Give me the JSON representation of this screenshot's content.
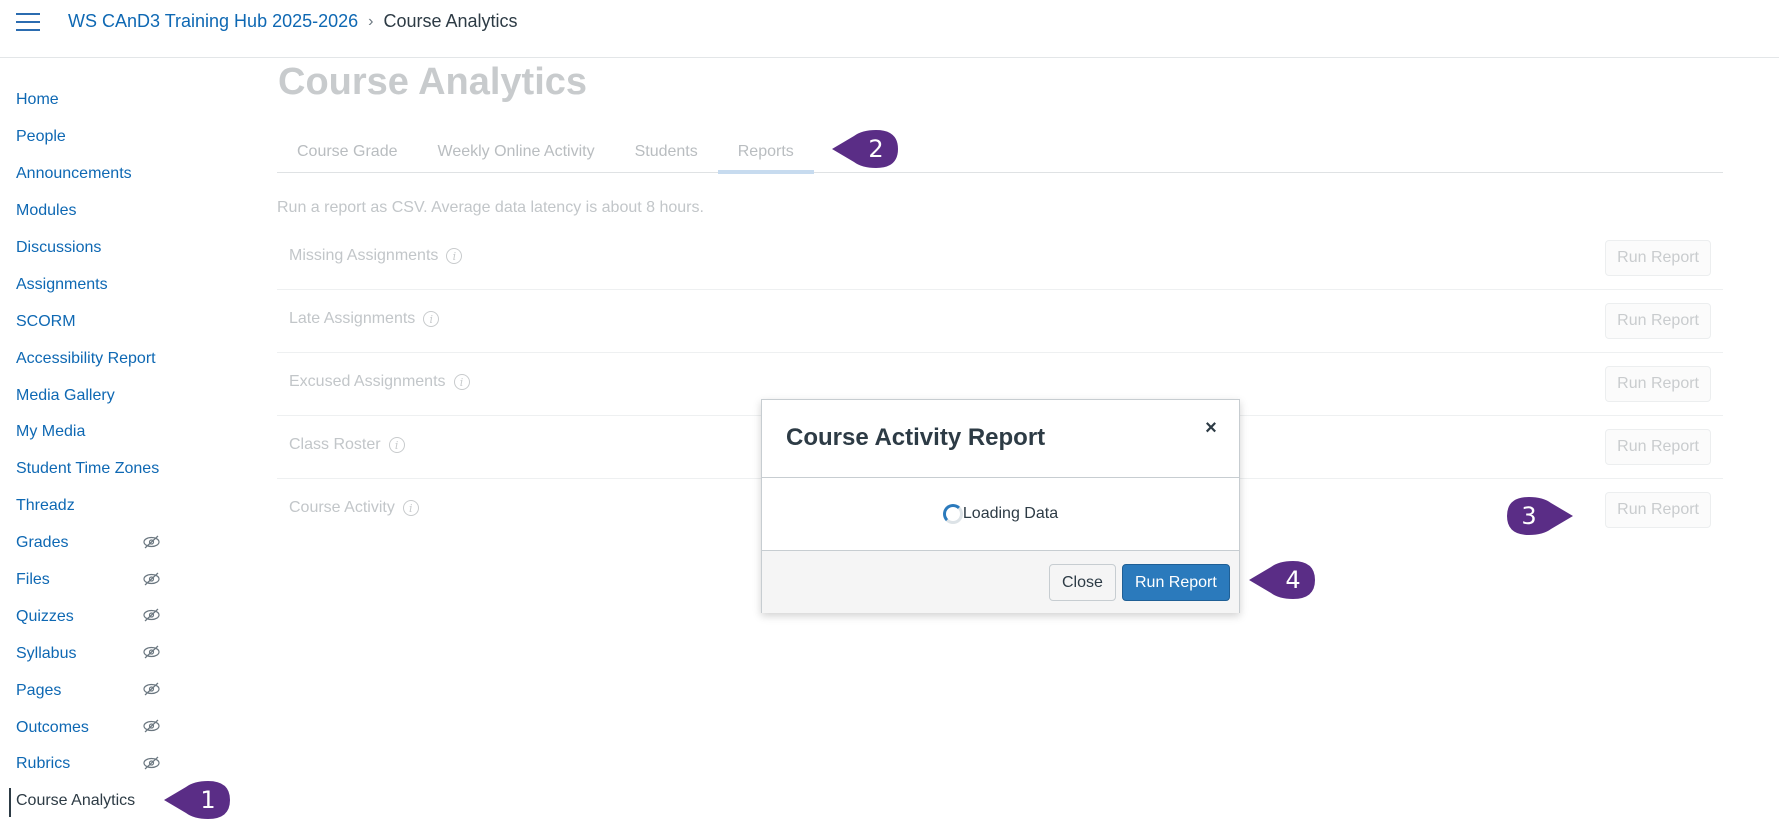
{
  "header": {
    "course_link": "WS CAnD3 Training Hub 2025-2026",
    "separator": "›",
    "current_page": "Course Analytics"
  },
  "sidebar": {
    "items": [
      {
        "label": "Home",
        "hidden": false
      },
      {
        "label": "People",
        "hidden": false
      },
      {
        "label": "Announcements",
        "hidden": false
      },
      {
        "label": "Modules",
        "hidden": false
      },
      {
        "label": "Discussions",
        "hidden": false
      },
      {
        "label": "Assignments",
        "hidden": false
      },
      {
        "label": "SCORM",
        "hidden": false
      },
      {
        "label": "Accessibility Report",
        "hidden": false
      },
      {
        "label": "Media Gallery",
        "hidden": false
      },
      {
        "label": "My Media",
        "hidden": false
      },
      {
        "label": "Student Time Zones",
        "hidden": false
      },
      {
        "label": "Threadz",
        "hidden": false
      },
      {
        "label": "Grades",
        "hidden": true
      },
      {
        "label": "Files",
        "hidden": true
      },
      {
        "label": "Quizzes",
        "hidden": true
      },
      {
        "label": "Syllabus",
        "hidden": true
      },
      {
        "label": "Pages",
        "hidden": true
      },
      {
        "label": "Outcomes",
        "hidden": true
      },
      {
        "label": "Rubrics",
        "hidden": true
      },
      {
        "label": "Course Analytics",
        "hidden": false,
        "active": true
      }
    ]
  },
  "main": {
    "title": "Course Analytics",
    "tabs": [
      {
        "label": "Course Grade"
      },
      {
        "label": "Weekly Online Activity"
      },
      {
        "label": "Students"
      },
      {
        "label": "Reports",
        "active": true
      }
    ],
    "intro": "Run a report as CSV. Average data latency is about 8 hours.",
    "reports": [
      {
        "name": "Missing Assignments",
        "button": "Run Report"
      },
      {
        "name": "Late Assignments",
        "button": "Run Report"
      },
      {
        "name": "Excused Assignments",
        "button": "Run Report"
      },
      {
        "name": "Class Roster",
        "button": "Run Report"
      },
      {
        "name": "Course Activity",
        "button": "Run Report"
      }
    ]
  },
  "modal": {
    "title": "Course Activity Report",
    "close_symbol": "×",
    "loading_text": "Loading Data",
    "close_button": "Close",
    "run_button": "Run Report"
  },
  "callouts": [
    "1",
    "2",
    "3",
    "4"
  ],
  "colors": {
    "link": "#0e68b3",
    "callout": "#5a2d86",
    "primary_button": "#2b7abc"
  }
}
